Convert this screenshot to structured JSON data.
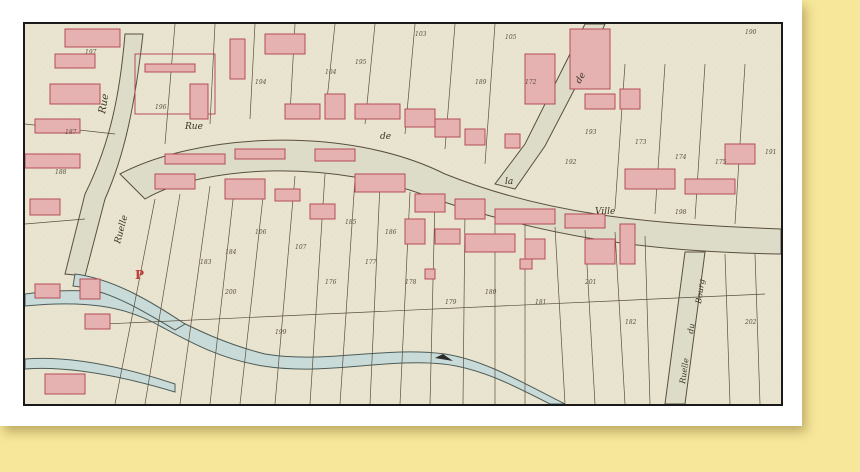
{
  "map": {
    "street_labels": {
      "rue_top": "Rue",
      "de_top": "de",
      "main_rue": "Rue",
      "main_de": "de",
      "main_la": "la",
      "main_ville": "Ville",
      "ruelle_left": "Ruelle",
      "ruelle_right": "Ruelle",
      "du": "du",
      "right_tail": "Bourg"
    },
    "marker_letter": "P",
    "parcel_numbers": [
      "103",
      "104",
      "105",
      "106",
      "107",
      "172",
      "173",
      "174",
      "175",
      "176",
      "177",
      "178",
      "179",
      "180",
      "181",
      "182",
      "183",
      "184",
      "185",
      "186",
      "187",
      "188",
      "189",
      "190",
      "191",
      "192",
      "193",
      "194",
      "195",
      "196",
      "197",
      "198",
      "199",
      "200",
      "201",
      "202"
    ],
    "colors": {
      "parchment": "#e9e4cf",
      "building": "#e5b1b1",
      "building_stroke": "#b54d57",
      "street": "#dcdcc8",
      "water": "#c9dbd8",
      "ink": "#3a3326",
      "page_bg": "#f7e79a"
    }
  }
}
